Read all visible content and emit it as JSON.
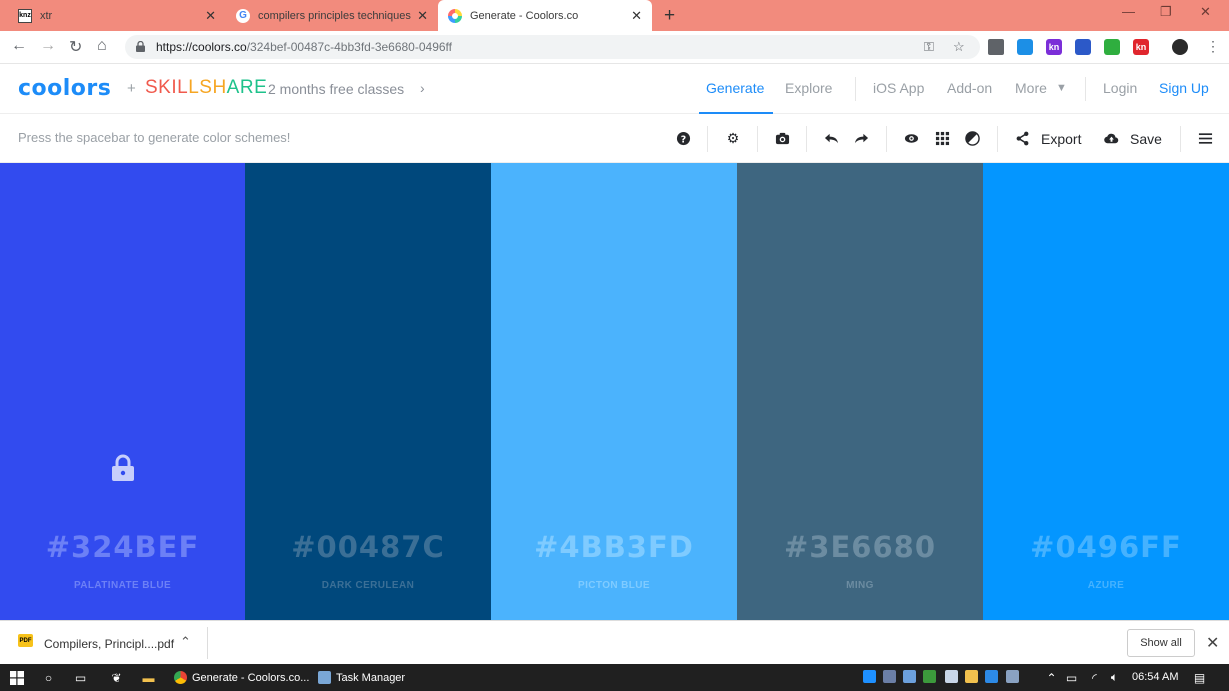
{
  "browser": {
    "tabs": [
      {
        "title": "xtr",
        "favicon": "knz-favicon"
      },
      {
        "title": "compilers principles techniques a",
        "favicon": "google-favicon"
      },
      {
        "title": "Generate - Coolors.co",
        "favicon": "coolors-favicon",
        "active": true
      }
    ],
    "url_host": "https://coolors.co",
    "url_path": "/324bef-00487c-4bb3fd-3e6680-0496ff"
  },
  "header": {
    "logo": "coolors",
    "plus": "+",
    "partner": "SKILLSHARE",
    "promo": "2 months free classes",
    "nav": {
      "generate": "Generate",
      "explore": "Explore",
      "ios_app": "iOS App",
      "addon": "Add-on",
      "more": "More",
      "login": "Login",
      "signup": "Sign Up"
    },
    "accent": "#1d8cf8"
  },
  "toolbar": {
    "hint": "Press the spacebar to generate color schemes!",
    "export_label": "Export",
    "save_label": "Save"
  },
  "palette": [
    {
      "hex": "#324BEF",
      "name": "PALATINATE BLUE",
      "color": "#324bef",
      "text_color": "#6c80f6",
      "locked": true
    },
    {
      "hex": "#00487C",
      "name": "DARK CERULEAN",
      "color": "#00487c",
      "text_color": "#3b6f96",
      "locked": false
    },
    {
      "hex": "#4BB3FD",
      "name": "PICTON BLUE",
      "color": "#4bb3fd",
      "text_color": "#7fcbff",
      "locked": false
    },
    {
      "hex": "#3E6680",
      "name": "MING",
      "color": "#3e6680",
      "text_color": "#6c8ca1",
      "locked": false
    },
    {
      "hex": "#0496FF",
      "name": "AZURE",
      "color": "#0496ff",
      "text_color": "#45b2ff",
      "locked": false
    }
  ],
  "downloads": {
    "file": "Compilers, Principl....pdf",
    "show_all": "Show all"
  },
  "taskbar": {
    "apps": [
      {
        "label": "Generate - Coolors.co..."
      },
      {
        "label": "Task Manager"
      }
    ],
    "clock": "06:54 AM"
  }
}
